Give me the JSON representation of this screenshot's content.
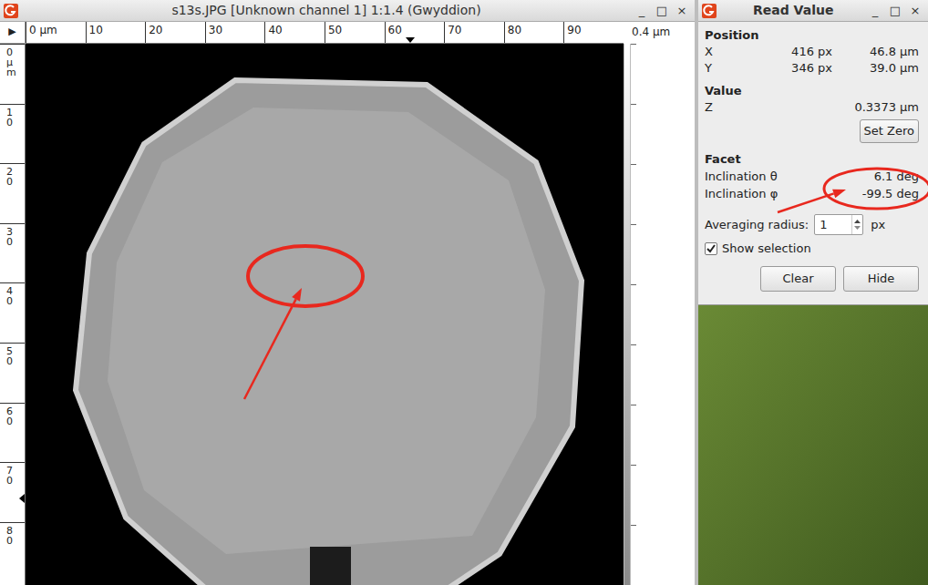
{
  "main_window": {
    "title": "s13s.JPG [Unknown channel 1] 1:1.4 (Gwyddion)",
    "controls": [
      "_",
      "□",
      "×"
    ]
  },
  "corner_button": "▶",
  "h_ruler": {
    "ticks": [
      "0 µm",
      "10",
      "20",
      "30",
      "40",
      "50",
      "60",
      "70",
      "80",
      "90"
    ]
  },
  "v_ruler": {
    "ticks": [
      "0 µm",
      "10",
      "20",
      "30",
      "40",
      "50",
      "60",
      "70",
      "80"
    ]
  },
  "color_scale": {
    "max_label": "0.4 µm"
  },
  "read_value": {
    "title": "Read Value",
    "controls": [
      "_",
      "□",
      "×"
    ],
    "position": {
      "heading": "Position",
      "rows": [
        {
          "axis": "X",
          "px": "416 px",
          "value": "46.8 µm"
        },
        {
          "axis": "Y",
          "px": "346 px",
          "value": "39.0 µm"
        }
      ]
    },
    "value": {
      "heading": "Value",
      "label": "Z",
      "reading": "0.3373 µm",
      "button": "Set Zero"
    },
    "facet": {
      "heading": "Facet",
      "rows": [
        {
          "label": "Inclination θ",
          "value": "6.1 deg"
        },
        {
          "label": "Inclination φ",
          "value": "-99.5 deg"
        }
      ]
    },
    "averaging": {
      "label": "Averaging radius:",
      "value": "1",
      "unit": "px"
    },
    "show_selection": {
      "label": "Show selection",
      "checked": true
    },
    "buttons": [
      "Clear",
      "Hide"
    ]
  }
}
